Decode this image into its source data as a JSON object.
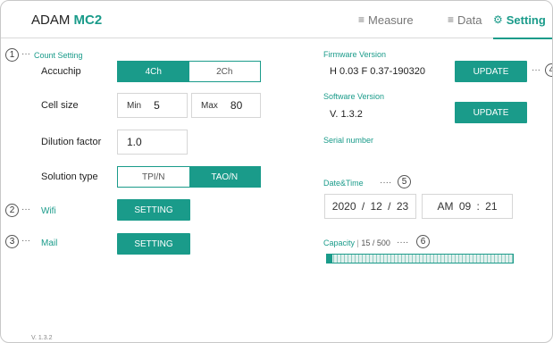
{
  "header": {
    "brand": "ADAM",
    "model": "MC2",
    "nav": [
      {
        "label": "Measure",
        "icon": "menu-icon"
      },
      {
        "label": "Data",
        "icon": "list-icon"
      },
      {
        "label": "Setting",
        "icon": "gear-icon",
        "active": true
      }
    ]
  },
  "callouts": [
    "1",
    "2",
    "3",
    "4",
    "5",
    "6"
  ],
  "count_setting": {
    "title": "Count Setting",
    "accuchip": {
      "label": "Accuchip",
      "options": [
        "4Ch",
        "2Ch"
      ],
      "selected": "4Ch"
    },
    "cell_size": {
      "label": "Cell size",
      "min_label": "Min",
      "min_value": "5",
      "max_label": "Max",
      "max_value": "80"
    },
    "dilution": {
      "label": "Dilution factor",
      "value": "1.0"
    },
    "solution": {
      "label": "Solution type",
      "options": [
        "TPI/N",
        "TAO/N"
      ],
      "selected": "TAO/N"
    }
  },
  "wifi": {
    "label": "Wifi",
    "button": "SETTING"
  },
  "mail": {
    "label": "Mail",
    "button": "SETTING"
  },
  "firmware": {
    "title": "Firmware Version",
    "value": "H 0.03 F 0.37-190320",
    "button": "UPDATE"
  },
  "software": {
    "title": "Software Version",
    "value": "V. 1.3.2",
    "button": "UPDATE"
  },
  "serial": {
    "title": "Serial number"
  },
  "datetime": {
    "title": "Date&Time",
    "date": "2020 / 12 / 23",
    "time": "AM 09 : 21"
  },
  "capacity": {
    "title": "Capacity",
    "used": "15 / 500",
    "fraction": 0.03
  },
  "footer": {
    "version": "V. 1.3.2"
  },
  "colors": {
    "accent": "#1a9b8a"
  }
}
